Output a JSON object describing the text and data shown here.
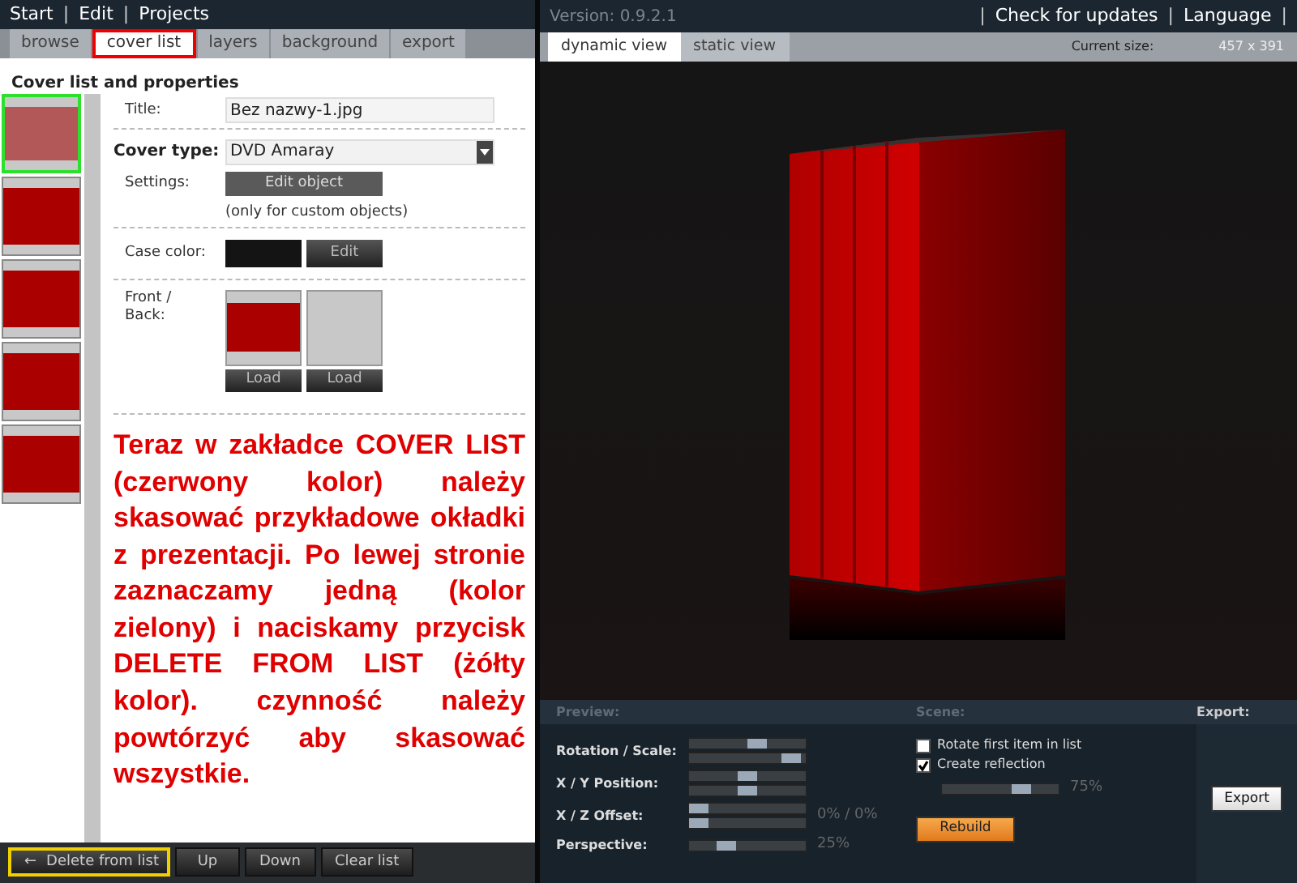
{
  "left_menu": [
    "Start",
    "Edit",
    "Projects"
  ],
  "separator": "|",
  "left_tabs": [
    {
      "label": "browse",
      "selected": false
    },
    {
      "label": "cover list",
      "selected": true
    },
    {
      "label": "layers",
      "selected": false
    },
    {
      "label": "background",
      "selected": false
    },
    {
      "label": "export",
      "selected": false
    }
  ],
  "heading": "Cover list and properties",
  "covers": [
    {
      "selected": true
    },
    {
      "selected": false
    },
    {
      "selected": false
    },
    {
      "selected": false
    },
    {
      "selected": false
    }
  ],
  "title_label": "Title:",
  "title_value": "Bez nazwy-1.jpg",
  "cover_type_label": "Cover type:",
  "cover_type_value": "DVD Amaray",
  "settings_label": "Settings:",
  "edit_object_button": "Edit object",
  "settings_note": "(only for custom objects)",
  "case_color_label": "Case color:",
  "case_color_button": "Edit",
  "front_back_label": "Front / Back:",
  "load_buttons": [
    "Load",
    "Load"
  ],
  "annotation": "Teraz w zakładce COVER LIST (czerwony kolor) należy skasować przykładowe okładki z prezentacji. Po lewej stronie zaznaczamy jedną (kolor zielony) i naciskamy przycisk DELETE FROM LIST (żółty kolor). czynność należy powtórzyć aby skasować wszystkie.",
  "bottom_buttons": [
    {
      "label": "Delete from list",
      "highlighted": true,
      "arrow": "←"
    },
    {
      "label": "Up",
      "highlighted": false
    },
    {
      "label": "Down",
      "highlighted": false
    },
    {
      "label": "Clear list",
      "highlighted": false
    }
  ],
  "version": "Version: 0.9.2.1",
  "right_menu": [
    "Check for updates",
    "Language"
  ],
  "view_tabs": [
    {
      "label": "dynamic view",
      "selected": true
    },
    {
      "label": "static view",
      "selected": false
    }
  ],
  "current_size_label": "Current size:",
  "current_size_value": "457 x 391",
  "preview_label": "Preview:",
  "scene_label": "Scene:",
  "export_label": "Export:",
  "preview_rows": [
    {
      "label": "Rotation / Scale:",
      "sliders": [
        {
          "level": 0.6
        },
        {
          "level": 0.95
        }
      ]
    },
    {
      "label": "X / Y Position:",
      "sliders": [
        {
          "level": 0.5
        },
        {
          "level": 0.5
        }
      ]
    },
    {
      "label": "X / Z Offset:",
      "sliders": [
        {
          "level": 0.0
        },
        {
          "level": 0.0
        }
      ],
      "reading": "0% / 0%"
    },
    {
      "label": "Perspective:",
      "sliders": [
        {
          "level": 0.28
        }
      ],
      "reading": "25%"
    }
  ],
  "scene_options": [
    {
      "label": "Rotate first item in list",
      "checked": false
    },
    {
      "label": "Create reflection",
      "checked": true
    }
  ],
  "reflection": {
    "level": 0.72,
    "reading": "75%"
  },
  "rebuild_button": "Rebuild",
  "export_button": "Export"
}
